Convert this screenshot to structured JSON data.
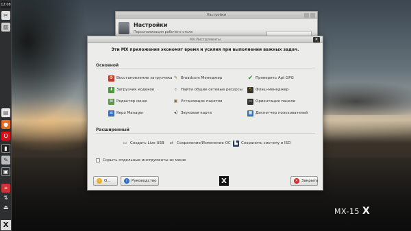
{
  "panel": {
    "clock": "12:08",
    "icons": [
      "tools-icon",
      "workspace-icon",
      "document-icon",
      "firefox-icon",
      "opera-icon",
      "terminal-icon",
      "editor-icon",
      "monitor-icon",
      "flag-icon",
      "network-icon",
      "usb-icon",
      "mx-menu-icon"
    ]
  },
  "bg_window": {
    "titlebar": "Настройки",
    "title": "Настройки",
    "subtitle": "Персонализация рабочего стола"
  },
  "dialog": {
    "titlebar": "MX Инструменты",
    "header": "Эти MX приложения экономят время и усилия при выполнении важных задач.",
    "sections": {
      "basic": "Основной",
      "advanced": "Расширенный"
    },
    "tools_basic": [
      {
        "label": "Восстановление загрузчика",
        "icon": "boot-repair-icon"
      },
      {
        "label": "Broadcom Менеджер",
        "icon": "broadcom-icon"
      },
      {
        "label": "Проверить Apt GPG",
        "icon": "checkmark-icon"
      },
      {
        "label": "Загрузчик кодеков",
        "icon": "codecs-icon"
      },
      {
        "label": "Найти общие сетевые ресурсы",
        "icon": "search-icon"
      },
      {
        "label": "Флэш-менеджер",
        "icon": "flash-icon"
      },
      {
        "label": "Редактор меню",
        "icon": "menu-editor-icon"
      },
      {
        "label": "Установщик пакетов",
        "icon": "package-icon"
      },
      {
        "label": "Ориентация панели",
        "icon": "panel-icon"
      },
      {
        "label": "Repo Manager",
        "icon": "repo-icon"
      },
      {
        "label": "Звуковая карта",
        "icon": "speaker-icon"
      },
      {
        "label": "Диспетчер пользователей",
        "icon": "users-icon"
      }
    ],
    "tools_advanced": [
      {
        "label": "Создать Live USB",
        "icon": "usb-drive-icon"
      },
      {
        "label": "Сохранение/Изменение ОС",
        "icon": "remaster-icon"
      },
      {
        "label": "Сохранить систему в ISO",
        "icon": "snapshot-icon"
      }
    ],
    "hide_checkbox": "Скрыть отдельные инструменты из меню",
    "buttons": {
      "about": "О...",
      "help": "Руководство",
      "close": "Закрыть"
    }
  },
  "brand": {
    "text": "MX-15"
  }
}
